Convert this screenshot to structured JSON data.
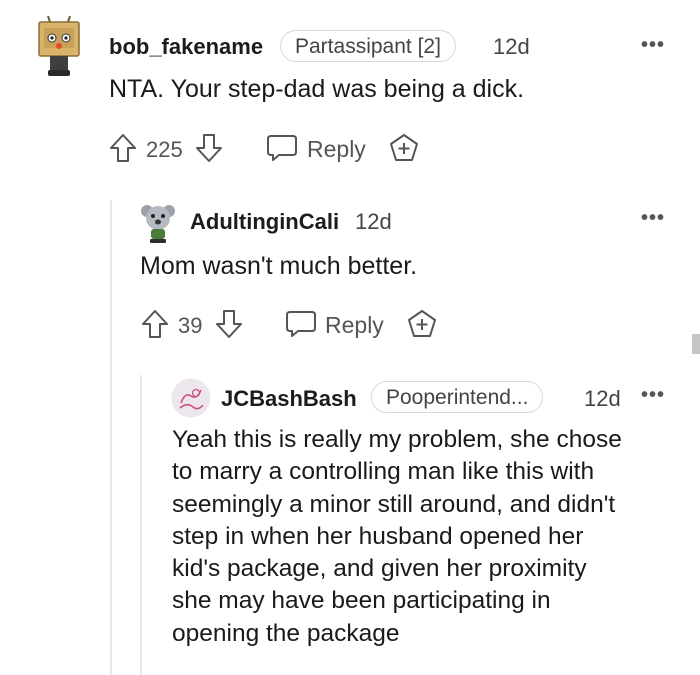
{
  "comments": [
    {
      "username": "bob_fakename",
      "flair": "Partassipant [2]",
      "time": "12d",
      "body": "NTA. Your step-dad was being a dick.",
      "score": "225",
      "reply_label": "Reply",
      "more": "•••",
      "avatar": "box-robot-avatar"
    },
    {
      "username": "AdultinginCali",
      "time": "12d",
      "body": "Mom wasn't much better.",
      "score": "39",
      "reply_label": "Reply",
      "more": "•••",
      "avatar": "koala-avatar"
    },
    {
      "username": "JCBashBash",
      "flair": "Pooperintend...",
      "time": "12d",
      "body": "Yeah this is really my problem, she chose\nto marry a controlling man like this with\nseemingly a minor still around, and didn't\nstep in when her husband opened her\nkid's package, and given her proximity\nshe may have been participating in\nopening the package",
      "more": "•••",
      "avatar": "script-logo-avatar"
    }
  ],
  "colors": {
    "text": "#1a1a1b",
    "muted": "#555555",
    "thread_line": "#e7e7e7",
    "flair_border": "#d9d9d9"
  }
}
